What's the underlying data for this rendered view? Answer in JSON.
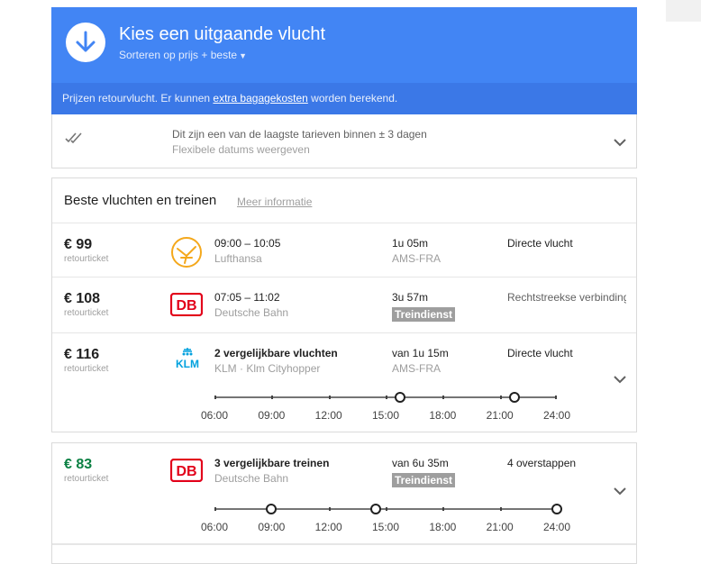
{
  "header": {
    "title": "Kies een uitgaande vlucht",
    "sort_label": "Sorteren op prijs + beste",
    "color": "#4285f4"
  },
  "info_bar": {
    "text_before": "Prijzen retourvlucht. Er kunnen ",
    "link": "extra bagagekosten",
    "text_after": " worden berekend."
  },
  "fare_notice": {
    "line1": "Dit zijn een van de laagste tarieven binnen ± 3 dagen",
    "line2": "Flexibele datums weergeven"
  },
  "best": {
    "title": "Beste vluchten en treinen",
    "more": "Meer informatie",
    "rows": [
      {
        "price": "€ 99",
        "price_sub": "retourticket",
        "logo": "lufthansa-logo",
        "times": "09:00 – 10:05",
        "carrier": "Lufthansa",
        "duration": "1u 05m",
        "route": "AMS-FRA",
        "stops": "Directe vlucht"
      },
      {
        "price": "€ 108",
        "price_sub": "retourticket",
        "logo": "db-logo",
        "logo_text": "DB",
        "times": "07:05 – 11:02",
        "carrier": "Deutsche Bahn",
        "duration": "3u 57m",
        "badge": "Treindienst",
        "stops": "Rechtstreekse verbinding"
      },
      {
        "price": "€ 116",
        "price_sub": "retourticket",
        "logo": "klm-logo",
        "logo_text": "KLM",
        "times": "2 vergelijkbare vluchten",
        "carrier": "KLM · Klm Cityhopper",
        "duration": "van 1u 15m",
        "route": "AMS-FRA",
        "stops": "Directe vlucht",
        "timeline": {
          "labels": [
            "06:00",
            "09:00",
            "12:00",
            "15:00",
            "18:00",
            "21:00",
            "24:00"
          ],
          "departures": [
            "15:45",
            "21:45"
          ]
        }
      }
    ]
  },
  "trains": {
    "price": "€ 83",
    "price_sub": "retourticket",
    "logo_text": "DB",
    "times": "3 vergelijkbare treinen",
    "carrier": "Deutsche Bahn",
    "duration": "van 6u 35m",
    "badge": "Treindienst",
    "stops": "4 overstappen",
    "timeline": {
      "labels": [
        "06:00",
        "09:00",
        "12:00",
        "15:00",
        "18:00",
        "21:00",
        "24:00"
      ],
      "departures": [
        "09:00",
        "14:30",
        "24:00"
      ]
    }
  }
}
